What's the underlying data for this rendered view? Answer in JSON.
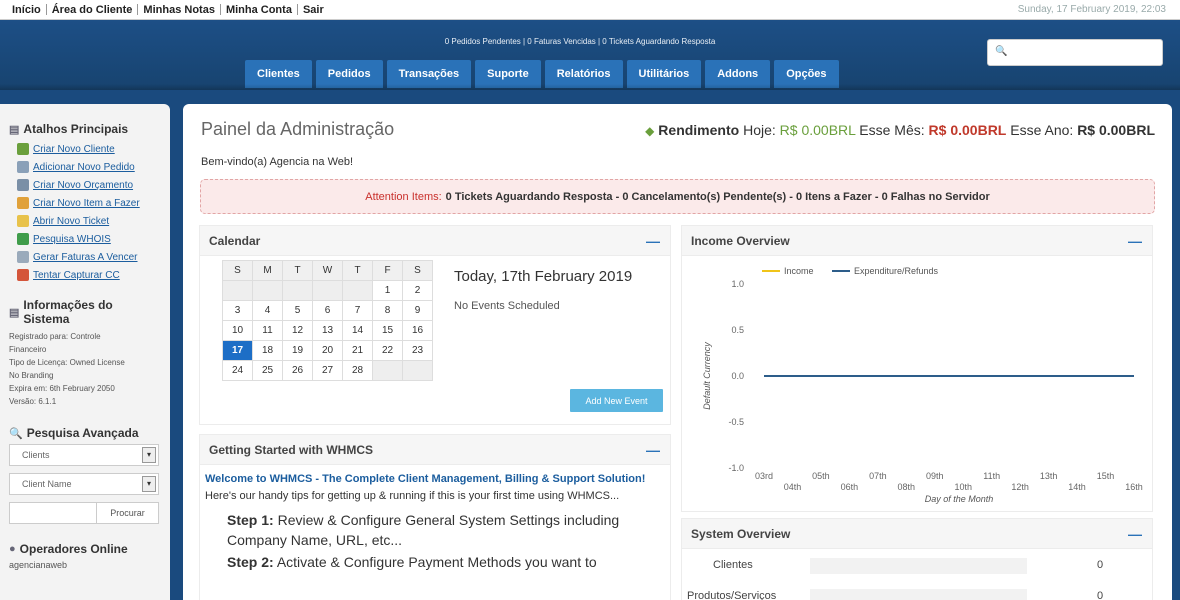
{
  "topnav": {
    "links": [
      "Início",
      "Área do Cliente",
      "Minhas Notas",
      "Minha Conta",
      "Sair"
    ],
    "datetime": "Sunday, 17 February 2019, 22:03"
  },
  "header": {
    "notices": "0 Pedidos Pendentes | 0 Faturas Vencidas | 0 Tickets Aguardando Resposta",
    "search_value": "",
    "tabs": [
      "Clientes",
      "Pedidos",
      "Transações",
      "Suporte",
      "Relatórios",
      "Utilitários",
      "Addons",
      "Opções"
    ]
  },
  "sidebar": {
    "shortcuts_title": "Atalhos Principais",
    "shortcuts": [
      {
        "label": "Criar Novo Cliente",
        "icon": "user-add-icon",
        "color": "#6a9f3c"
      },
      {
        "label": "Adicionar Novo Pedido",
        "icon": "cart-add-icon",
        "color": "#8aa0b8"
      },
      {
        "label": "Criar Novo Orçamento",
        "icon": "quote-icon",
        "color": "#7a8fa6"
      },
      {
        "label": "Criar Novo Item a Fazer",
        "icon": "todo-icon",
        "color": "#e0a13a"
      },
      {
        "label": "Abrir Novo Ticket",
        "icon": "ticket-icon",
        "color": "#e8c24a"
      },
      {
        "label": "Pesquisa WHOIS",
        "icon": "globe-icon",
        "color": "#3f9c4a"
      },
      {
        "label": "Gerar Faturas A Vencer",
        "icon": "invoice-icon",
        "color": "#9aaabb"
      },
      {
        "label": "Tentar Capturar CC",
        "icon": "card-icon",
        "color": "#d4553a"
      }
    ],
    "sysinfo_title": "Informações do Sistema",
    "sysinfo_lines": [
      "Registrado para: Controle",
      "Financeiro",
      "Tipo de Licença: Owned License",
      "No Branding",
      "Expira em: 6th February 2050",
      "Versão: 6.1.1"
    ],
    "advsearch_title": "Pesquisa Avançada",
    "advsearch_type": "Clients",
    "advsearch_field": "Client Name",
    "advsearch_button": "Procurar",
    "operators_title": "Operadores Online",
    "operators": "agencianaweb"
  },
  "main": {
    "title": "Painel da Administração",
    "revenue_label": "Rendimento",
    "today_label": "Hoje:",
    "today_value": "R$ 0.00BRL",
    "month_label": "Esse Mês:",
    "month_value": "R$ 0.00BRL",
    "year_label": "Esse Ano:",
    "year_value": "R$ 0.00BRL",
    "welcome": "Bem-vindo(a) Agencia na Web!",
    "attention": {
      "label": "Attention Items:",
      "items": [
        "0 Tickets Aguardando Resposta",
        "0 Cancelamento(s) Pendente(s)",
        "0 Itens a Fazer",
        "0 Falhas no Servidor"
      ]
    }
  },
  "calendar": {
    "title": "Calendar",
    "weekdays": [
      "S",
      "M",
      "T",
      "W",
      "T",
      "F",
      "S"
    ],
    "weeks": [
      [
        "",
        "",
        "",
        "",
        "",
        "1",
        "2"
      ],
      [
        "3",
        "4",
        "5",
        "6",
        "7",
        "8",
        "9"
      ],
      [
        "10",
        "11",
        "12",
        "13",
        "14",
        "15",
        "16"
      ],
      [
        "17",
        "18",
        "19",
        "20",
        "21",
        "22",
        "23"
      ],
      [
        "24",
        "25",
        "26",
        "27",
        "28",
        "",
        ""
      ]
    ],
    "today_day": "17",
    "today_label": "Today, 17th February 2019",
    "events": "No Events Scheduled",
    "add_button": "Add New Event"
  },
  "getting_started": {
    "title": "Getting Started with WHMCS",
    "welcome": "Welcome to WHMCS - The Complete Client Management, Billing & Support Solution!",
    "intro": "Here's our handy tips for getting up & running if this is your first time using WHMCS...",
    "steps": [
      {
        "label": "Step 1:",
        "text": "Review & Configure General System Settings including Company Name, URL, etc..."
      },
      {
        "label": "Step 2:",
        "text": "Activate & Configure Payment Methods you want to"
      }
    ]
  },
  "income": {
    "title": "Income Overview"
  },
  "chart_data": {
    "type": "line",
    "title": "",
    "xlabel": "Day of the Month",
    "ylabel": "Default Currency",
    "x": [
      "03rd",
      "04th",
      "05th",
      "06th",
      "07th",
      "08th",
      "09th",
      "10th",
      "11th",
      "12th",
      "13th",
      "14th",
      "15th",
      "16th"
    ],
    "ylim": [
      -1.0,
      1.0
    ],
    "yticks": [
      "1.0",
      "0.5",
      "0.0",
      "-0.5",
      "-1.0"
    ],
    "legend_position": "top",
    "series": [
      {
        "name": "Income",
        "color": "#f0c419",
        "values": [
          0,
          0,
          0,
          0,
          0,
          0,
          0,
          0,
          0,
          0,
          0,
          0,
          0,
          0
        ]
      },
      {
        "name": "Expenditure/Refunds",
        "color": "#2d5d8a",
        "values": [
          0,
          0,
          0,
          0,
          0,
          0,
          0,
          0,
          0,
          0,
          0,
          0,
          0,
          0
        ]
      }
    ]
  },
  "system_overview": {
    "title": "System Overview",
    "rows": [
      {
        "label": "Clientes",
        "value": "0"
      },
      {
        "label": "Produtos/Serviços",
        "value": "0"
      }
    ]
  },
  "colors": {
    "header_bg": "#1d4f86",
    "tab_bg": "#2a72b8",
    "today_cell": "#1d6ec6",
    "attention_bg": "#fbeaea",
    "revenue_green": "#6a9f3c",
    "revenue_red": "#c0392b"
  }
}
